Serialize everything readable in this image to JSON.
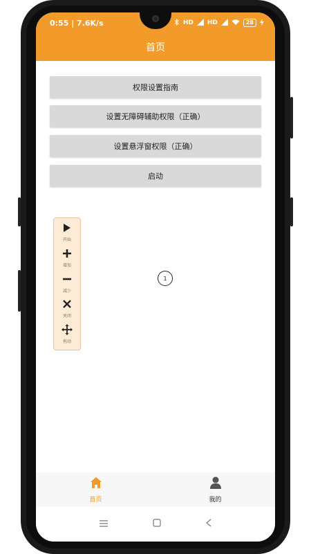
{
  "status_bar": {
    "time_speed": "0:55 | 7.6K/s",
    "signal1": "HD",
    "signal2": "HD",
    "battery": "28"
  },
  "app_bar": {
    "title": "首页"
  },
  "buttons": {
    "guide": "权限设置指南",
    "accessibility": "设置无障碍辅助权限（正确）",
    "overlay": "设置悬浮窗权限（正确）",
    "start": "启动"
  },
  "float_panel": {
    "items": [
      {
        "label": "开始",
        "icon": "play-icon"
      },
      {
        "label": "增加",
        "icon": "plus-icon"
      },
      {
        "label": "减少",
        "icon": "minus-icon"
      },
      {
        "label": "关闭",
        "icon": "close-icon"
      },
      {
        "label": "拖动",
        "icon": "move-icon"
      }
    ]
  },
  "marker": {
    "number": "1"
  },
  "bottom_nav": {
    "items": [
      {
        "label": "首页",
        "icon": "home-icon",
        "active": true
      },
      {
        "label": "我的",
        "icon": "person-icon",
        "active": false
      }
    ]
  },
  "colors": {
    "accent": "#f29a2a",
    "panel_bg": "#fdebd6",
    "button_bg": "#d9d9d9"
  }
}
